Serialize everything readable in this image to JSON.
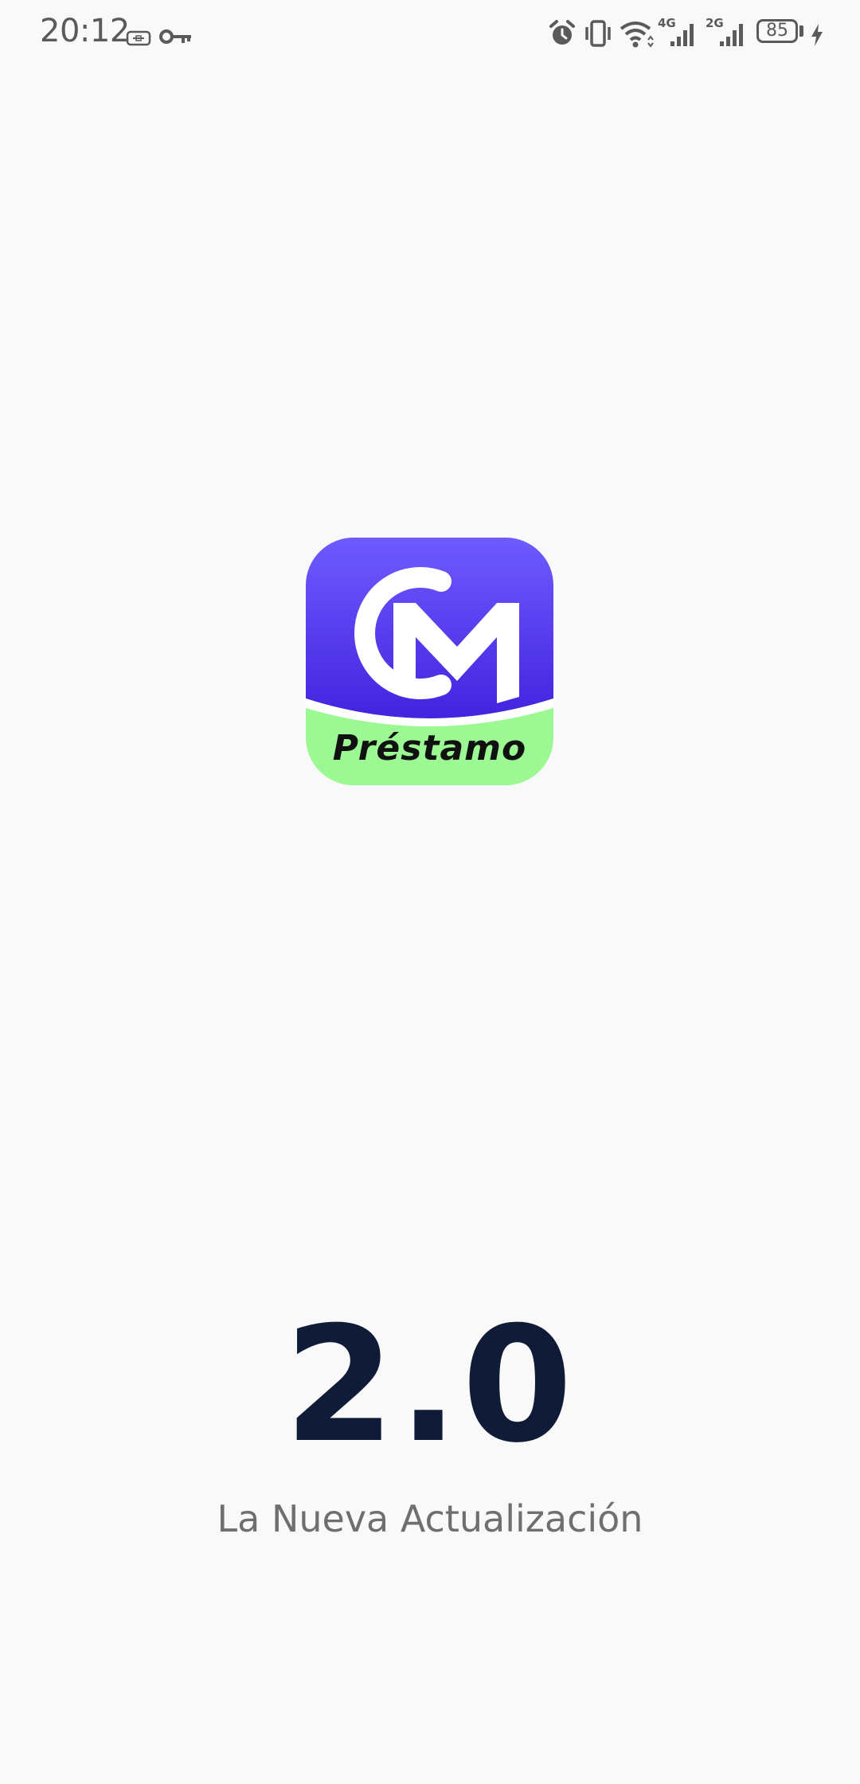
{
  "status_bar": {
    "time": "20:12",
    "network_primary": "4G",
    "network_secondary": "2G",
    "battery_level": "85",
    "icons": [
      "sim-card-icon",
      "vpn-key-icon",
      "alarm-icon",
      "vibrate-icon",
      "wifi-icon",
      "signal-icon",
      "signal-icon",
      "battery-icon",
      "charging-icon"
    ]
  },
  "app": {
    "logo_word": "Préstamo",
    "logo_colors": {
      "top": "#6f5bff",
      "bottom": "#4323df",
      "band": "#9bf893"
    },
    "version": "2.0",
    "tagline": "La Nueva Actualización"
  }
}
